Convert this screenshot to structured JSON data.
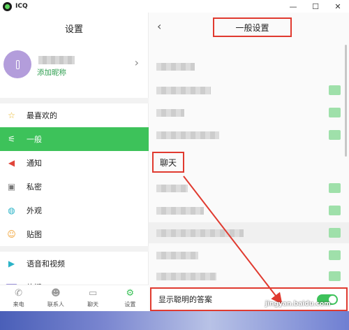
{
  "window": {
    "app_title": "ICQ",
    "minimize": "—",
    "maximize": "☐",
    "close": "✕"
  },
  "left": {
    "header": "设置",
    "profile": {
      "nickname_link": "添加昵称"
    },
    "menu": [
      {
        "label": "最喜欢的",
        "icon": "star-icon",
        "glyph": "☆",
        "color": "#e9b423"
      },
      {
        "label": "一般",
        "icon": "sliders-icon",
        "glyph": "⚟",
        "color": "#ffffff",
        "active": true
      },
      {
        "label": "通知",
        "icon": "speaker-icon",
        "glyph": "🔈",
        "color": "#e0453a"
      },
      {
        "label": "私密",
        "icon": "lock-icon",
        "glyph": "🔒",
        "color": "#777777"
      },
      {
        "label": "外观",
        "icon": "palette-icon",
        "glyph": "◍",
        "color": "#2bb3c7"
      },
      {
        "label": "贴图",
        "icon": "sticker-icon",
        "glyph": "☺",
        "color": "#f0a030"
      },
      {
        "label": "语音和视频",
        "icon": "camera-icon",
        "glyph": "▶",
        "color": "#2bb3c7"
      },
      {
        "label": "热键",
        "icon": "keyboard-icon",
        "glyph": "⌨",
        "color": "#7b6fd0"
      }
    ],
    "bottom_nav": [
      {
        "label": "来电",
        "icon": "phone-icon",
        "glyph": "✆"
      },
      {
        "label": "联系人",
        "icon": "contacts-icon",
        "glyph": "👥"
      },
      {
        "label": "聊天",
        "icon": "chat-icon",
        "glyph": "💬"
      },
      {
        "label": "设置",
        "icon": "settings-icon",
        "glyph": "⚙",
        "active": true
      }
    ]
  },
  "right": {
    "back": "‹",
    "title": "一般设置",
    "section_label": "聊天",
    "last_setting": {
      "label": "显示聪明的答案",
      "enabled": true
    }
  },
  "watermark": "jingyan.baidu.com",
  "colors": {
    "accent": "#3dc25a",
    "annotation_red": "#e03a2f"
  }
}
